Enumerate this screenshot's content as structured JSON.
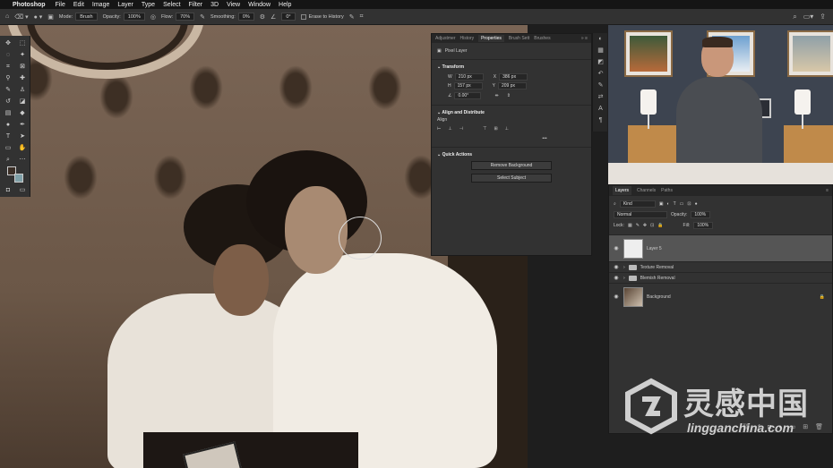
{
  "menubar": {
    "app_name": "Photoshop",
    "items": [
      "File",
      "Edit",
      "Image",
      "Layer",
      "Type",
      "Select",
      "Filter",
      "3D",
      "View",
      "Window",
      "Help"
    ]
  },
  "options": {
    "mode_label": "Mode:",
    "mode_value": "Brush",
    "opacity_label": "Opacity:",
    "opacity_value": "100%",
    "flow_label": "Flow:",
    "flow_value": "70%",
    "smoothing_label": "Smoothing:",
    "smoothing_value": "0%",
    "angle_value": "0°",
    "erase_history_label": "Erase to History"
  },
  "properties": {
    "tabs": [
      "Adjustmer",
      "History",
      "Properties",
      "Brush Sett",
      "Brushes"
    ],
    "active_tab": "Properties",
    "layer_type": "Pixel Layer",
    "transform_header": "Transform",
    "w_label": "W",
    "w_value": "210 px",
    "h_label": "H",
    "h_value": "157 px",
    "x_label": "X",
    "x_value": "386 px",
    "y_label": "Y",
    "y_value": "209 px",
    "angle_value": "0.00°",
    "align_header": "Align and Distribute",
    "align_label": "Align",
    "more": "•••",
    "quick_header": "Quick Actions",
    "btn_remove_bg": "Remove Background",
    "btn_select_subject": "Select Subject"
  },
  "layers": {
    "tabs": [
      "Layers",
      "Channels",
      "Paths"
    ],
    "active_tab": "Layers",
    "kind_value": "Kind",
    "blend_value": "Normal",
    "opacity_label": "Opacity:",
    "opacity_value": "100%",
    "lock_label": "Lock:",
    "fill_label": "Fill:",
    "fill_value": "100%",
    "items": [
      {
        "name": "Layer 5",
        "type": "pixel",
        "selected": true
      },
      {
        "name": "Texture Removal",
        "type": "group",
        "selected": false
      },
      {
        "name": "Blemish Removal",
        "type": "group",
        "selected": false
      },
      {
        "name": "Background",
        "type": "photo",
        "selected": false
      }
    ]
  },
  "watermark": {
    "cn": "灵感中国",
    "en": "lingganchina.com"
  },
  "colors": {
    "panel_bg": "#323232",
    "panel_dark": "#262626",
    "selected_layer": "#555555"
  }
}
